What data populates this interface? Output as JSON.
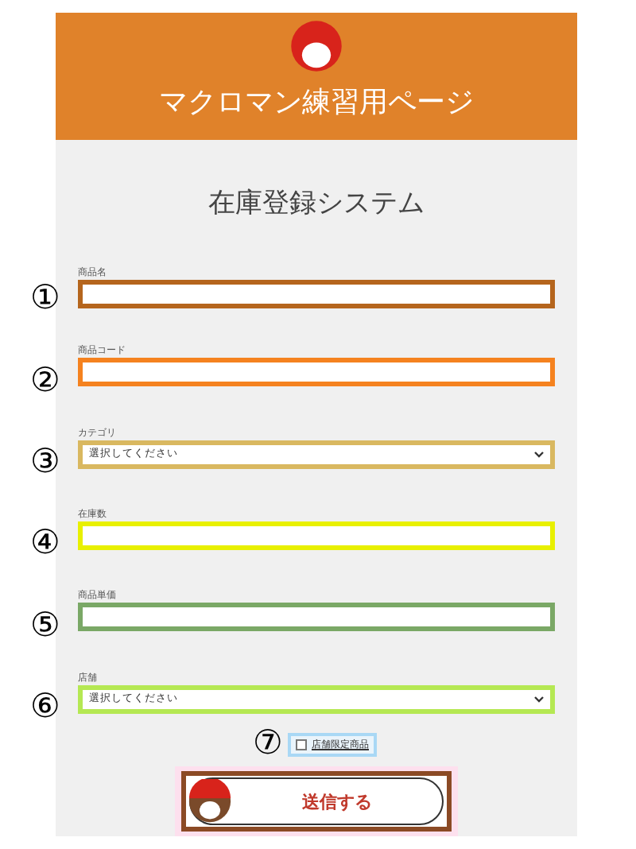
{
  "header": {
    "title": "マクロマン練習用ページ"
  },
  "form": {
    "title": "在庫登録システム",
    "fields": [
      {
        "marker": "①",
        "label": "商品名",
        "kind": "text",
        "color": "#b5651d"
      },
      {
        "marker": "②",
        "label": "商品コード",
        "kind": "text",
        "color": "#f5821f"
      },
      {
        "marker": "③",
        "label": "カテゴリ",
        "kind": "select",
        "placeholder": "選択してください",
        "color": "#d9b860"
      },
      {
        "marker": "④",
        "label": "在庫数",
        "kind": "text",
        "color": "#e8f000"
      },
      {
        "marker": "⑤",
        "label": "商品単価",
        "kind": "text",
        "color": "#7aa866"
      },
      {
        "marker": "⑥",
        "label": "店舗",
        "kind": "select",
        "placeholder": "選択してください",
        "color": "#b5e853"
      }
    ],
    "checkbox": {
      "marker": "⑦",
      "label": "店舗限定商品",
      "checked": false,
      "color": "#a9d8f5"
    },
    "submit": {
      "label": "送信する"
    }
  }
}
